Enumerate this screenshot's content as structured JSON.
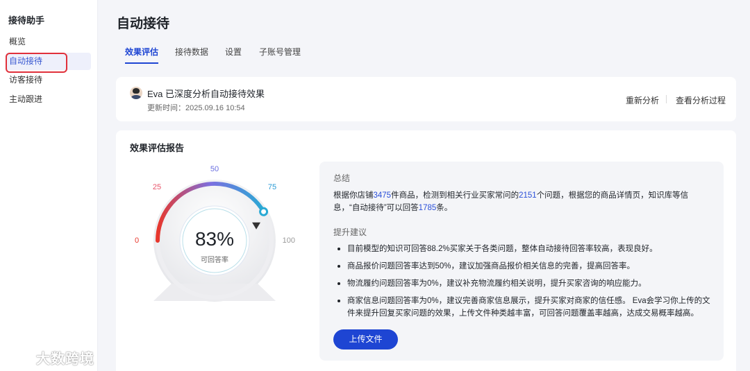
{
  "sidebar": {
    "title": "接待助手",
    "items": [
      {
        "label": "概览"
      },
      {
        "label": "自动接待"
      },
      {
        "label": "访客接待"
      },
      {
        "label": "主动跟进"
      }
    ]
  },
  "page_title": "自动接待",
  "tabs": [
    {
      "label": "效果评估"
    },
    {
      "label": "接待数据"
    },
    {
      "label": "设置"
    },
    {
      "label": "子账号管理"
    }
  ],
  "analysis_bar": {
    "title": "Eva 已深度分析自动接待效果",
    "update_time": "更新时间：2025.09.16 10:54",
    "reanalyze_label": "重新分析",
    "view_process_label": "查看分析过程"
  },
  "report": {
    "title": "效果评估报告",
    "gauge": {
      "value_text": "83%",
      "value_fraction": 0.83,
      "caption": "可回答率",
      "ticks": [
        "0",
        "25",
        "50",
        "75",
        "100"
      ]
    },
    "summary": {
      "heading": "总结",
      "p_a": "根据你店铺",
      "p_n1": "3475",
      "p_b": "件商品，检测到相关行业买家常问的",
      "p_n2": "2151",
      "p_c": "个问题，根据您的商品详情页，知识库等信息，“自动接待”可以回答",
      "p_n3": "1785",
      "p_d": "条。",
      "suggest_heading": "提升建议",
      "suggestions": [
        "目前模型的知识可回答88.2%买家关于各类问题，整体自动接待回答率较高，表现良好。",
        "商品报价问题回答率达到50%，建议加强商品报价相关信息的完善，提高回答率。",
        "物流履约问题回答率为0%，建议补充物流履约相关说明，提升买家咨询的响应能力。",
        "商家信息问题回答率为0%，建议完善商家信息展示，提升买家对商家的信任感。 Eva会学习你上传的文件来提升回复买家问题的效果，上传文件种类越丰富，可回答问题覆盖率越高，达成交易概率越高。"
      ],
      "upload_label": "上传文件"
    }
  },
  "watermark": {
    "text": "大数跨境"
  },
  "colors": {
    "accent": "#1e45d3",
    "highlight": "#2a4fd8",
    "gauge_start": "#e8372c",
    "gauge_mid": "#7b6fe0",
    "gauge_end": "#29a9d4",
    "tick_zero": "#e8372c",
    "tick_25": "#e8546a",
    "tick_50": "#6a6fe0",
    "tick_75": "#2a9bd6"
  }
}
